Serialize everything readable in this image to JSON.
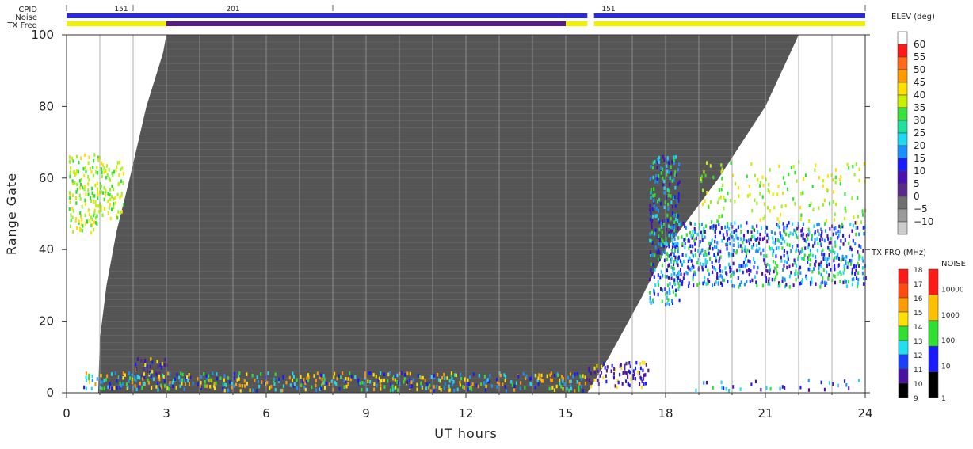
{
  "chart_data": {
    "type": "heatmap",
    "xlabel": "UT hours",
    "ylabel": "Range Gate",
    "xlim": [
      0,
      24
    ],
    "ylim": [
      0,
      100
    ],
    "xticks": [
      0,
      3,
      6,
      9,
      12,
      15,
      18,
      21,
      24
    ],
    "yticks": [
      0,
      20,
      40,
      60,
      80,
      100
    ],
    "xtick_labels": [
      "0",
      "3",
      "6",
      "9",
      "12",
      "15",
      "18",
      "21",
      "24"
    ],
    "ytick_labels": [
      "0",
      "20",
      "40",
      "60",
      "80",
      "100"
    ],
    "grid": "vertical lines every hour",
    "no_coverage_color": "#555555",
    "no_coverage_region": {
      "left_edge": [
        [
          0.95,
          0
        ],
        [
          1.0,
          15
        ],
        [
          1.2,
          30
        ],
        [
          1.5,
          45
        ],
        [
          1.9,
          60
        ],
        [
          2.4,
          80
        ],
        [
          2.9,
          95
        ],
        [
          3.0,
          100
        ]
      ],
      "right_edge": [
        [
          15.65,
          0
        ],
        [
          16.3,
          10
        ],
        [
          17.3,
          27
        ],
        [
          18.0,
          40
        ],
        [
          19.6,
          60
        ],
        [
          21.0,
          80
        ],
        [
          22.0,
          100
        ]
      ]
    },
    "top_strips": {
      "labels": [
        "CPID",
        "Noise",
        "TX Freq"
      ],
      "cpid_segments": [
        {
          "start": 0,
          "end": 2,
          "value": "151"
        },
        {
          "start": 2,
          "end": 8,
          "value": "201"
        },
        {
          "start": 8,
          "end": 24,
          "value": "151"
        }
      ],
      "cpid_text": [
        "151",
        "201",
        "151"
      ],
      "noise_color": "#2a2ae0",
      "noise_gap": [
        15.65,
        15.85
      ],
      "txfreq_segments": [
        {
          "start": 0,
          "end": 3,
          "color": "#f2f000"
        },
        {
          "start": 3,
          "end": 15,
          "color": "#5a1a8a"
        },
        {
          "start": 15,
          "end": 15.65,
          "color": "#f2f000"
        },
        {
          "start": 15.85,
          "end": 24,
          "color": "#f2f000"
        }
      ]
    },
    "colorbars": [
      {
        "title": "ELEV (deg)",
        "labels": [
          "60",
          "55",
          "50",
          "45",
          "40",
          "35",
          "30",
          "25",
          "20",
          "15",
          "10",
          "5",
          "0",
          "−5",
          "−10"
        ],
        "colors": [
          "#ffffff",
          "#ff1a1a",
          "#ff6a1a",
          "#ff9a00",
          "#ffe000",
          "#c8f000",
          "#3ce03c",
          "#20e0a0",
          "#20d8f0",
          "#1a90ff",
          "#1a1aff",
          "#4a10b0",
          "#5a2a8a",
          "#707070",
          "#9a9a9a",
          "#cccccc"
        ]
      },
      {
        "title": "TX FRQ (MHz)",
        "labels": [
          "18",
          "17",
          "16",
          "15",
          "14",
          "13",
          "12",
          "11",
          "10",
          "9"
        ],
        "colors": [
          "#ff1a1a",
          "#ff4a10",
          "#ff9a00",
          "#ffe000",
          "#30e030",
          "#20e0f0",
          "#1a40ff",
          "#4a10a0",
          "#000000"
        ]
      },
      {
        "title": "NOISE",
        "labels": [
          "10000",
          "1000",
          "100",
          "10",
          "1"
        ],
        "colors": [
          "#ff1a1a",
          "#ffc000",
          "#30e030",
          "#1a1aff",
          "#000000"
        ]
      }
    ],
    "echo_patches": [
      {
        "t0": 0.05,
        "t1": 1.0,
        "g0": 44,
        "g1": 66,
        "dominant": "yellow-green (35-45 deg)"
      },
      {
        "t0": 1.0,
        "t1": 1.7,
        "g0": 48,
        "g1": 64,
        "dominant": "yellow-green (35-45 deg)"
      },
      {
        "t0": 2.0,
        "t1": 3.0,
        "g0": 4,
        "g1": 9,
        "dominant": "yellow / purple"
      },
      {
        "t0": 0.5,
        "t1": 15.6,
        "g0": 0,
        "g1": 5,
        "dominant": "cyan-blue-green near ground"
      },
      {
        "t0": 15.6,
        "t1": 17.5,
        "g0": 1,
        "g1": 8,
        "dominant": "blue/purple"
      },
      {
        "t0": 17.5,
        "t1": 18.4,
        "g0": 24,
        "g1": 66,
        "dominant": "blue (10-25 deg)"
      },
      {
        "t0": 18.0,
        "t1": 24.0,
        "g0": 29,
        "g1": 47,
        "dominant": "blue (15-25 deg)"
      },
      {
        "t0": 19.0,
        "t1": 24.0,
        "g0": 47,
        "g1": 64,
        "dominant": "yellow (40-45 deg) sparse"
      },
      {
        "t0": 18.5,
        "t1": 24.0,
        "g0": 0,
        "g1": 3,
        "dominant": "green sparse"
      }
    ]
  }
}
